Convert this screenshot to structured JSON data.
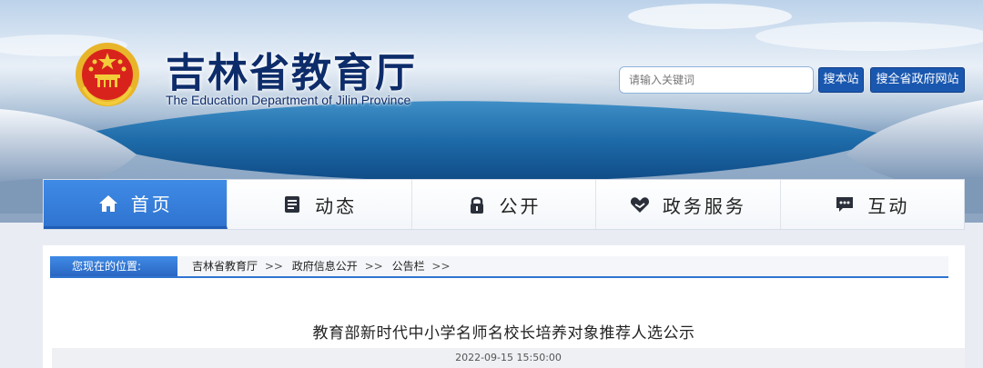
{
  "header": {
    "site_title": "吉林省教育厅",
    "site_subtitle": "The Education Department of Jilin Province",
    "emblem_icon": "national-emblem-icon"
  },
  "search": {
    "placeholder": "请输入关键词",
    "search_site_label": "搜本站",
    "search_province_label": "搜全省政府网站"
  },
  "nav": {
    "items": [
      {
        "label": "首页",
        "icon": "home-icon",
        "active": true
      },
      {
        "label": "动态",
        "icon": "document-icon",
        "active": false
      },
      {
        "label": "公开",
        "icon": "lock-icon",
        "active": false
      },
      {
        "label": "政务服务",
        "icon": "handshake-heart-icon",
        "active": false
      },
      {
        "label": "互动",
        "icon": "chat-icon",
        "active": false
      }
    ]
  },
  "breadcrumb": {
    "label": "您现在的位置:",
    "items": [
      "吉林省教育厅",
      "政府信息公开",
      "公告栏"
    ],
    "separator": ">>"
  },
  "article": {
    "title": "教育部新时代中小学名师名校长培养对象推荐人选公示",
    "date": "2022-09-15 15:50:00"
  },
  "colors": {
    "accent": "#2f74d0",
    "title": "#0d2c6a"
  }
}
